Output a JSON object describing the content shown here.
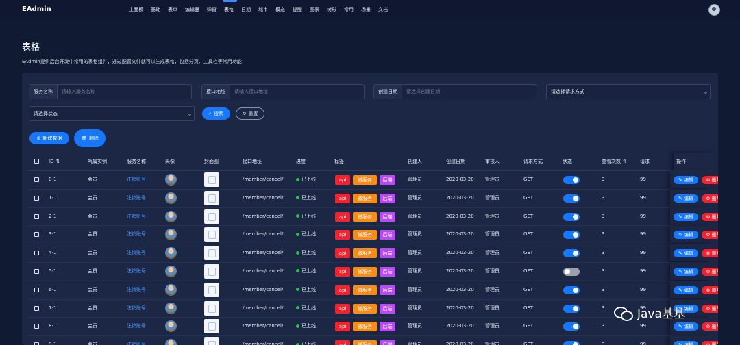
{
  "app": {
    "logo": "EAdmin"
  },
  "nav": [
    "主面板",
    "基础",
    "表单",
    "编辑器",
    "弹窗",
    "表格",
    "日期",
    "城市",
    "模态",
    "提醒",
    "图表",
    "树形",
    "常用",
    "场景",
    "文档"
  ],
  "nav_active_index": 5,
  "page": {
    "title": "表格",
    "description": "EAdmin提供后台开发中常用的表格组件，通过配置文件就可以生成表格，包括分页、工具栏等常用功能"
  },
  "filters": {
    "service_name": {
      "label": "服务名称",
      "placeholder": "请输入服务名称"
    },
    "api_address": {
      "label": "接口地址",
      "placeholder": "请输入接口地址"
    },
    "create_date": {
      "label": "创建日期",
      "placeholder": "请选择创建日期"
    },
    "request_method": {
      "placeholder": "请选择请求方式"
    },
    "status": {
      "placeholder": "请选择状态"
    },
    "search_label": "搜索",
    "reset_label": "重置"
  },
  "toolbar": {
    "add_label": "新建数据",
    "delete_label": "删除"
  },
  "table": {
    "headers": {
      "id": "ID",
      "instance": "所属实例",
      "service": "服务名称",
      "avatar": "头像",
      "cover": "封面图",
      "api": "接口地址",
      "progress": "进度",
      "tags": "标签",
      "creator": "创建人",
      "created": "创建日期",
      "reviewer": "审核人",
      "method": "请求方式",
      "status": "状态",
      "views": "查看次数",
      "req": "请求",
      "ops": "操作"
    },
    "rows": [
      {
        "id": "0-1",
        "instance": "会员",
        "service": "注销账号",
        "api": "/member/cancel/",
        "progress": "已上线",
        "tags": [
          "api",
          "微服务",
          "后端"
        ],
        "creator": "管理员",
        "created": "2020-03-20",
        "reviewer": "管理员",
        "method": "GET",
        "status": true,
        "views": "3",
        "req": "99"
      },
      {
        "id": "1-1",
        "instance": "会员",
        "service": "注销账号",
        "api": "/member/cancel/",
        "progress": "已上线",
        "tags": [
          "api",
          "微服务",
          "后端"
        ],
        "creator": "管理员",
        "created": "2020-03-20",
        "reviewer": "管理员",
        "method": "GET",
        "status": true,
        "views": "3",
        "req": "99"
      },
      {
        "id": "2-1",
        "instance": "会员",
        "service": "注销账号",
        "api": "/member/cancel/",
        "progress": "已上线",
        "tags": [
          "api",
          "微服务",
          "后端"
        ],
        "creator": "管理员",
        "created": "2020-03-20",
        "reviewer": "管理员",
        "method": "GET",
        "status": true,
        "views": "3",
        "req": "99"
      },
      {
        "id": "3-1",
        "instance": "会员",
        "service": "注销账号",
        "api": "/member/cancel/",
        "progress": "已上线",
        "tags": [
          "api",
          "微服务",
          "后端"
        ],
        "creator": "管理员",
        "created": "2020-03-20",
        "reviewer": "管理员",
        "method": "GET",
        "status": true,
        "views": "3",
        "req": "99"
      },
      {
        "id": "4-1",
        "instance": "会员",
        "service": "注销账号",
        "api": "/member/cancel/",
        "progress": "已上线",
        "tags": [
          "api",
          "微服务",
          "后端"
        ],
        "creator": "管理员",
        "created": "2020-03-20",
        "reviewer": "管理员",
        "method": "GET",
        "status": true,
        "views": "3",
        "req": "99"
      },
      {
        "id": "5-1",
        "instance": "会员",
        "service": "注销账号",
        "api": "/member/cancel/",
        "progress": "已上线",
        "tags": [
          "api",
          "微服务",
          "后端"
        ],
        "creator": "管理员",
        "created": "2020-03-20",
        "reviewer": "管理员",
        "method": "GET",
        "status": false,
        "views": "3",
        "req": "99"
      },
      {
        "id": "6-1",
        "instance": "会员",
        "service": "注销账号",
        "api": "/member/cancel/",
        "progress": "已上线",
        "tags": [
          "api",
          "微服务",
          "后端"
        ],
        "creator": "管理员",
        "created": "2020-03-20",
        "reviewer": "管理员",
        "method": "GET",
        "status": true,
        "views": "3",
        "req": "99"
      },
      {
        "id": "7-1",
        "instance": "会员",
        "service": "注销账号",
        "api": "/member/cancel/",
        "progress": "已上线",
        "tags": [
          "api",
          "微服务",
          "后端"
        ],
        "creator": "管理员",
        "created": "2020-03-20",
        "reviewer": "管理员",
        "method": "GET",
        "status": true,
        "views": "3",
        "req": "99"
      },
      {
        "id": "8-1",
        "instance": "会员",
        "service": "注销账号",
        "api": "/member/cancel/",
        "progress": "已上线",
        "tags": [
          "api",
          "微服务",
          "后端"
        ],
        "creator": "管理员",
        "created": "2020-03-20",
        "reviewer": "管理员",
        "method": "GET",
        "status": true,
        "views": "3",
        "req": "99"
      },
      {
        "id": "9-1",
        "instance": "会员",
        "service": "注销账号",
        "api": "/member/cancel/",
        "progress": "已上线",
        "tags": [
          "api",
          "微服务",
          "后端"
        ],
        "creator": "管理员",
        "created": "2020-03-20",
        "reviewer": "管理员",
        "method": "GET",
        "status": true,
        "views": "3",
        "req": "99"
      }
    ],
    "edit_label": "编辑",
    "delete_label": "删除"
  },
  "watermark": "Java基基",
  "colors": {
    "primary": "#1677ff",
    "danger": "#f5222d",
    "warning": "#fa8c16",
    "purple": "#b84af7",
    "success": "#23c343",
    "background": "#111a33"
  }
}
